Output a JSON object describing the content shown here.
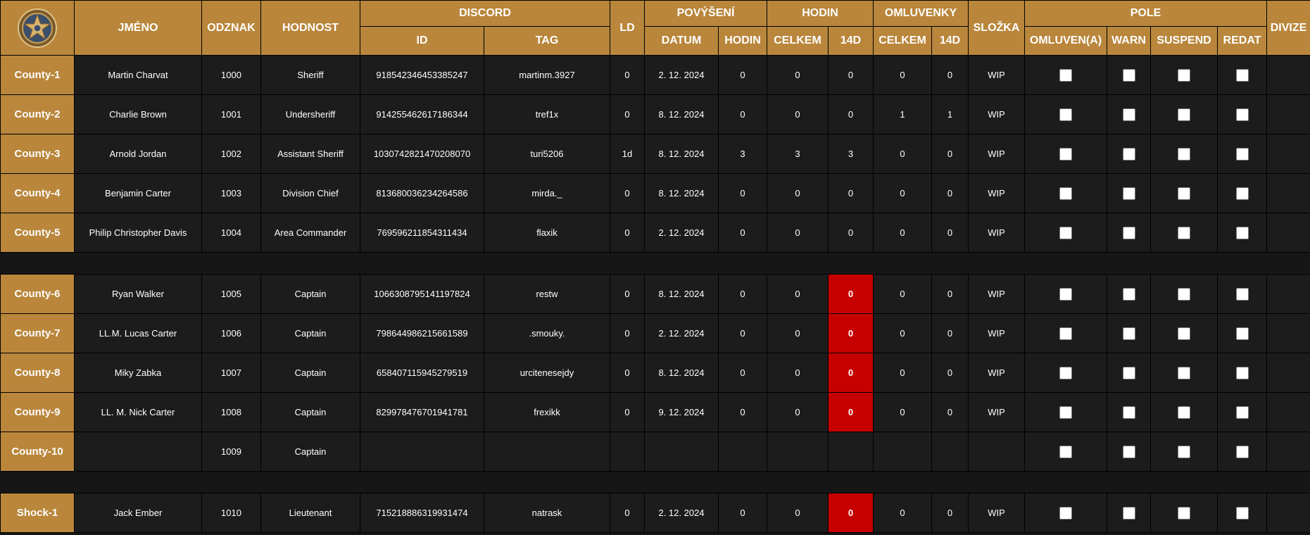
{
  "header": {
    "jmeno": "JMÉNO",
    "odznak": "ODZNAK",
    "hodnost": "HODNOST",
    "discord": "DISCORD",
    "discord_id": "ID",
    "discord_tag": "TAG",
    "ld": "LD",
    "povyseni": "POVÝŠENÍ",
    "povyseni_datum": "DATUM",
    "povyseni_hodin": "HODIN",
    "hodin": "HODIN",
    "hodin_celkem": "CELKEM",
    "hodin_14d": "14D",
    "omluvenky": "OMLUVENKY",
    "omluvenky_celkem": "CELKEM",
    "omluvenky_14d": "14D",
    "slozka": "SLOŽKA",
    "pole": "POLE",
    "pole_omluven": "OMLUVEN(A)",
    "pole_warn": "WARN",
    "pole_suspend": "SUSPEND",
    "pole_redat": "REDAT",
    "divize": "DIVIZE"
  },
  "logo": {
    "icon": "sheriff-star-badge-icon",
    "ring_color": "#c9a15a",
    "star_color": "#d9b26a"
  },
  "colors": {
    "header_bg": "#b9863b",
    "row_bg": "#1c1c1c",
    "alert_bg": "#c60000"
  },
  "rows": [
    {
      "unit": "County-1",
      "name": "Martin Charvat",
      "badge": "1000",
      "rank": "Sheriff",
      "discord_id": "918542346453385247",
      "tag": "martinm.3927",
      "ld": "0",
      "prom_date": "2. 12. 2024",
      "prom_hours": "0",
      "hours_total": "0",
      "hours_14d": "0",
      "exc_total": "0",
      "exc_14d": "0",
      "folder": "WIP",
      "alert": false
    },
    {
      "unit": "County-2",
      "name": "Charlie Brown",
      "badge": "1001",
      "rank": "Undersheriff",
      "discord_id": "914255462617186344",
      "tag": "tref1x",
      "ld": "0",
      "prom_date": "8. 12. 2024",
      "prom_hours": "0",
      "hours_total": "0",
      "hours_14d": "0",
      "exc_total": "1",
      "exc_14d": "1",
      "folder": "WIP",
      "alert": false
    },
    {
      "unit": "County-3",
      "name": "Arnold Jordan",
      "badge": "1002",
      "rank": "Assistant Sheriff",
      "discord_id": "1030742821470208070",
      "tag": "turi5206",
      "ld": "1d",
      "prom_date": "8. 12. 2024",
      "prom_hours": "3",
      "hours_total": "3",
      "hours_14d": "3",
      "exc_total": "0",
      "exc_14d": "0",
      "folder": "WIP",
      "alert": false
    },
    {
      "unit": "County-4",
      "name": "Benjamin Carter",
      "badge": "1003",
      "rank": "Division Chief",
      "discord_id": "813680036234264586",
      "tag": "mirda._",
      "ld": "0",
      "prom_date": "8. 12. 2024",
      "prom_hours": "0",
      "hours_total": "0",
      "hours_14d": "0",
      "exc_total": "0",
      "exc_14d": "0",
      "folder": "WIP",
      "alert": false
    },
    {
      "unit": "County-5",
      "name": "Philip Christopher Davis",
      "badge": "1004",
      "rank": "Area Commander",
      "discord_id": "769596211854311434",
      "tag": "flaxik",
      "ld": "0",
      "prom_date": "2. 12. 2024",
      "prom_hours": "0",
      "hours_total": "0",
      "hours_14d": "0",
      "exc_total": "0",
      "exc_14d": "0",
      "folder": "WIP",
      "alert": false
    },
    {
      "spacer": true
    },
    {
      "unit": "County-6",
      "name": "Ryan Walker",
      "badge": "1005",
      "rank": "Captain",
      "discord_id": "1066308795141197824",
      "tag": "restw",
      "ld": "0",
      "prom_date": "8. 12. 2024",
      "prom_hours": "0",
      "hours_total": "0",
      "hours_14d": "0",
      "exc_total": "0",
      "exc_14d": "0",
      "folder": "WIP",
      "alert": true
    },
    {
      "unit": "County-7",
      "name": "LL.M. Lucas Carter",
      "badge": "1006",
      "rank": "Captain",
      "discord_id": "798644986215661589",
      "tag": ".smouky.",
      "ld": "0",
      "prom_date": "2. 12. 2024",
      "prom_hours": "0",
      "hours_total": "0",
      "hours_14d": "0",
      "exc_total": "0",
      "exc_14d": "0",
      "folder": "WIP",
      "alert": true
    },
    {
      "unit": "County-8",
      "name": "Miky Zabka",
      "badge": "1007",
      "rank": "Captain",
      "discord_id": "658407115945279519",
      "tag": "urcitenesejdy",
      "ld": "0",
      "prom_date": "8. 12. 2024",
      "prom_hours": "0",
      "hours_total": "0",
      "hours_14d": "0",
      "exc_total": "0",
      "exc_14d": "0",
      "folder": "WIP",
      "alert": true
    },
    {
      "unit": "County-9",
      "name": "LL. M. Nick Carter",
      "badge": "1008",
      "rank": "Captain",
      "discord_id": "829978476701941781",
      "tag": "frexikk",
      "ld": "0",
      "prom_date": "9. 12. 2024",
      "prom_hours": "0",
      "hours_total": "0",
      "hours_14d": "0",
      "exc_total": "0",
      "exc_14d": "0",
      "folder": "WIP",
      "alert": true
    },
    {
      "unit": "County-10",
      "name": "",
      "badge": "1009",
      "rank": "Captain",
      "discord_id": "",
      "tag": "",
      "ld": "",
      "prom_date": "",
      "prom_hours": "",
      "hours_total": "",
      "hours_14d": "",
      "exc_total": "",
      "exc_14d": "",
      "folder": "",
      "alert": false
    },
    {
      "spacer": true
    },
    {
      "unit": "Shock-1",
      "name": "Jack Ember",
      "badge": "1010",
      "rank": "Lieutenant",
      "discord_id": "715218886319931474",
      "tag": "natrask",
      "ld": "0",
      "prom_date": "2. 12. 2024",
      "prom_hours": "0",
      "hours_total": "0",
      "hours_14d": "0",
      "exc_total": "0",
      "exc_14d": "0",
      "folder": "WIP",
      "alert": true
    }
  ]
}
